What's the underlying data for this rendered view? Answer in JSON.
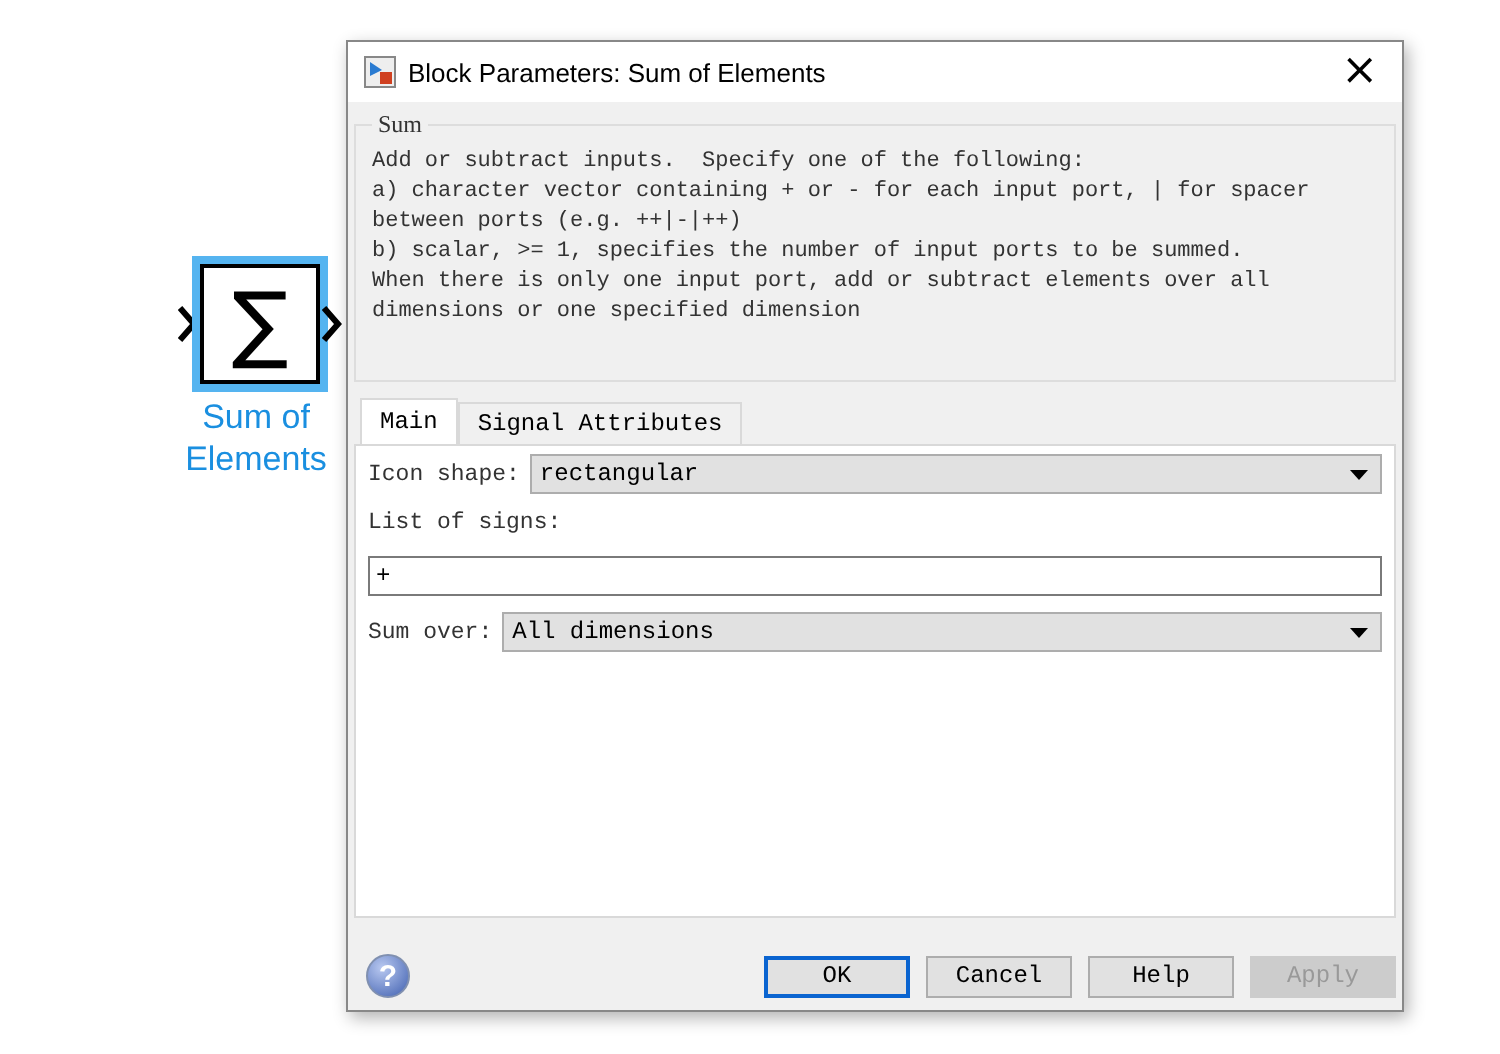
{
  "block": {
    "symbol": "∑",
    "label_lines": [
      "Sum of",
      "Elements"
    ],
    "selected": true
  },
  "window": {
    "title": "Block Parameters: Sum of Elements",
    "close": "×"
  },
  "group": {
    "title": "Sum",
    "lines": [
      "Add or subtract inputs.  Specify one of the following:",
      "a) character vector containing + or - for each input port, | for spacer",
      "between ports (e.g. ++|-|++)",
      "b) scalar, >= 1, specifies the number of input ports to be summed.",
      "When there is only one input port, add or subtract elements over all",
      "dimensions or one specified dimension"
    ]
  },
  "tabs": [
    {
      "label": "Main",
      "selected": true
    },
    {
      "label": "Signal Attributes",
      "selected": false
    }
  ],
  "fields": [
    {
      "kind": "select",
      "label": "Icon shape:",
      "value": "rectangular"
    },
    {
      "kind": "text",
      "label": "List of signs:",
      "value": "+"
    },
    {
      "kind": "select",
      "label": "Sum over:",
      "value": "All dimensions"
    }
  ],
  "help": "?",
  "buttons": [
    {
      "label": "OK",
      "default": true,
      "disabled": false
    },
    {
      "label": "Cancel",
      "default": false,
      "disabled": false
    },
    {
      "label": "Help",
      "default": false,
      "disabled": false
    },
    {
      "label": "Apply",
      "default": false,
      "disabled": true
    }
  ]
}
